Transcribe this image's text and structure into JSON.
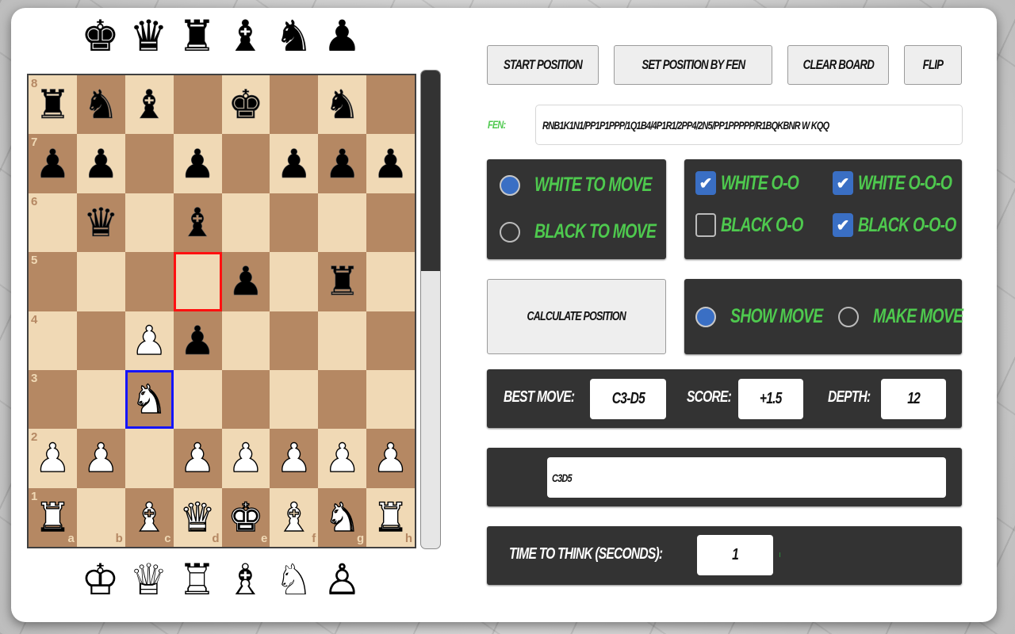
{
  "spare_pieces": {
    "black": [
      {
        "name": "king",
        "glyph": "♚"
      },
      {
        "name": "queen",
        "glyph": "♛"
      },
      {
        "name": "rook",
        "glyph": "♜"
      },
      {
        "name": "bishop",
        "glyph": "♝"
      },
      {
        "name": "knight",
        "glyph": "♞"
      },
      {
        "name": "pawn",
        "glyph": "♟"
      }
    ],
    "white": [
      {
        "name": "king",
        "glyph": "♔"
      },
      {
        "name": "queen",
        "glyph": "♕"
      },
      {
        "name": "rook",
        "glyph": "♖"
      },
      {
        "name": "bishop",
        "glyph": "♗"
      },
      {
        "name": "knight",
        "glyph": "♘"
      },
      {
        "name": "pawn",
        "glyph": "♙"
      }
    ]
  },
  "board": {
    "orientation": "white",
    "files": [
      "a",
      "b",
      "c",
      "d",
      "e",
      "f",
      "g",
      "h"
    ],
    "ranks": [
      "8",
      "7",
      "6",
      "5",
      "4",
      "3",
      "2",
      "1"
    ],
    "colors": {
      "light": "#f0d9b5",
      "dark": "#b58863",
      "highlight_from": "#1414ff",
      "highlight_to": "#ff1010"
    },
    "position": {
      "a8": "bR",
      "b8": "bN",
      "c8": "bB",
      "e8": "bK",
      "g8": "bN",
      "a7": "bP",
      "b7": "bP",
      "d7": "bP",
      "f7": "bP",
      "g7": "bP",
      "h7": "bP",
      "b6": "bQ",
      "d6": "bB",
      "e5": "bP",
      "g5": "bR",
      "c4": "wP",
      "d4": "bP",
      "c3": "wN",
      "a2": "wP",
      "b2": "wP",
      "d2": "wP",
      "e2": "wP",
      "f2": "wP",
      "g2": "wP",
      "h2": "wP",
      "a1": "wR",
      "c1": "wB",
      "d1": "wQ",
      "e1": "wK",
      "f1": "wB",
      "g1": "wN",
      "h1": "wR"
    },
    "highlight_from": "c3",
    "highlight_to": "d5"
  },
  "eval_bar": {
    "black_fraction": 0.42
  },
  "toolbar": {
    "start_position": "Start Position",
    "set_position_by_fen": "Set Position by FEN",
    "clear_board": "Clear Board",
    "flip": "Flip"
  },
  "fen": {
    "label": "FEN:",
    "value": "RNB1K1N1/PP1P1PPP/1Q1B4/4P1R1/2PP4/2N5/PP1PPPPP/R1BQKBNR W KQQ"
  },
  "side_to_move": {
    "white_label": "White to move",
    "black_label": "Black to move",
    "selected": "white"
  },
  "castling": {
    "white_kingside": {
      "label": "White O-O",
      "checked": true
    },
    "white_queenside": {
      "label": "White O-O-O",
      "checked": true
    },
    "black_kingside": {
      "label": "Black O-O",
      "checked": false
    },
    "black_queenside": {
      "label": "Black O-O-O",
      "checked": true
    }
  },
  "calculate_button": "Calculate Position",
  "move_mode": {
    "show_label": "Show move",
    "make_label": "Make move",
    "selected": "show"
  },
  "result": {
    "best_move_label": "Best move:",
    "best_move": "C3-D5",
    "score_label": "Score:",
    "score": "+1.5",
    "depth_label": "Depth:",
    "depth": "12"
  },
  "move_text": "C3D5",
  "think_time": {
    "label": "Time to think (seconds):",
    "value": "1"
  }
}
